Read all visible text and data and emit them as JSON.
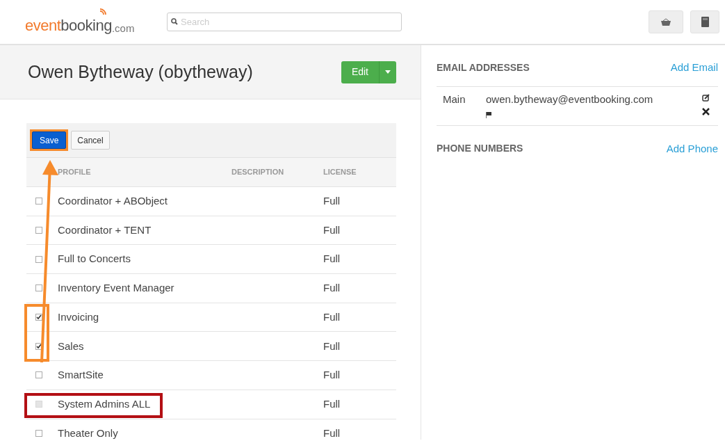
{
  "header": {
    "logo": {
      "part_1": "event",
      "part_2": "booking",
      "part_3": ".com"
    },
    "search": {
      "placeholder": "Search"
    }
  },
  "profile": {
    "title": "Owen Bytheway (obytheway)",
    "edit_button": "Edit"
  },
  "toolbar": {
    "save": {
      "label": "Save",
      "highlighted": true
    },
    "cancel": "Cancel"
  },
  "table": {
    "columns": [
      "PROFILE",
      "DESCRIPTION",
      "LICENSE"
    ],
    "rows": [
      {
        "profile": "Coordinator + ABObject",
        "license": "Full",
        "checked": false,
        "disabled": false,
        "checkbox_highlighted": false,
        "row_highlighted": false
      },
      {
        "profile": "Coordinator + TENT",
        "license": "Full",
        "checked": false,
        "disabled": false,
        "checkbox_highlighted": false,
        "row_highlighted": false
      },
      {
        "profile": "Full to Concerts",
        "license": "Full",
        "checked": false,
        "disabled": false,
        "checkbox_highlighted": false,
        "row_highlighted": false
      },
      {
        "profile": "Inventory Event Manager",
        "license": "Full",
        "checked": false,
        "disabled": false,
        "checkbox_highlighted": false,
        "row_highlighted": false
      },
      {
        "profile": "Invoicing",
        "license": "Full",
        "checked": true,
        "disabled": false,
        "checkbox_highlighted": true,
        "row_highlighted": false
      },
      {
        "profile": "Sales",
        "license": "Full",
        "checked": true,
        "disabled": false,
        "checkbox_highlighted": true,
        "row_highlighted": false
      },
      {
        "profile": "SmartSite",
        "license": "Full",
        "checked": false,
        "disabled": false,
        "checkbox_highlighted": false,
        "row_highlighted": false
      },
      {
        "profile": "System Admins ALL",
        "license": "Full",
        "checked": false,
        "disabled": true,
        "checkbox_highlighted": false,
        "row_highlighted": true
      },
      {
        "profile": "Theater Only",
        "license": "Full",
        "checked": false,
        "disabled": false,
        "checkbox_highlighted": false,
        "row_highlighted": false
      }
    ]
  },
  "email_section": {
    "title": "EMAIL ADDRESSES",
    "add_link": "Add Email",
    "entries": [
      {
        "label": "Main",
        "address": "owen.bytheway@eventbooking.com"
      }
    ]
  },
  "phone_section": {
    "title": "PHONE NUMBERS",
    "add_link": "Add Phone"
  }
}
